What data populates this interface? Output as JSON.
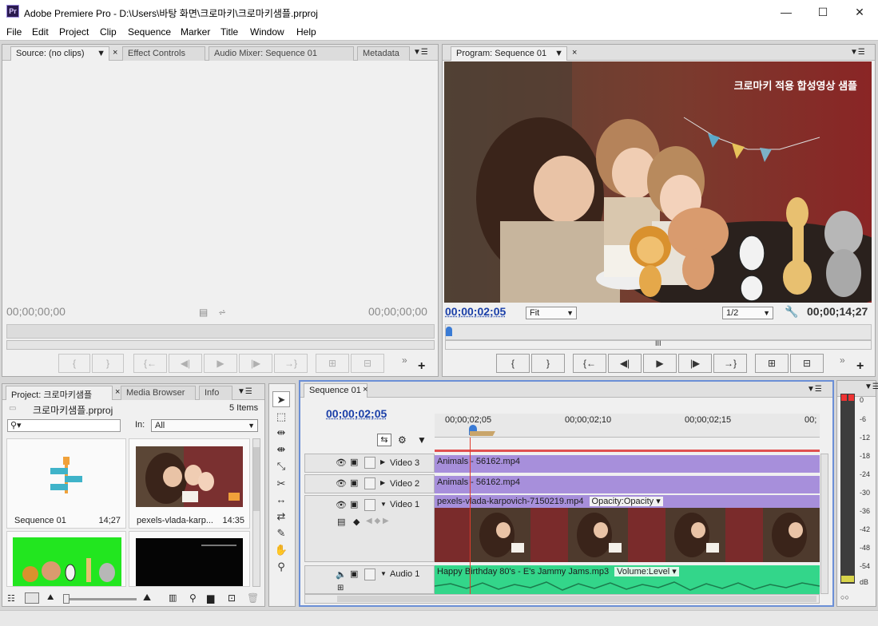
{
  "window": {
    "app_icon": "Pr",
    "title": "Adobe Premiere Pro - D:\\Users\\바탕 화면\\크로마키\\크로마키샘플.prproj",
    "minimize": "—",
    "maximize": "☐",
    "close": "✕"
  },
  "menu": [
    "File",
    "Edit",
    "Project",
    "Clip",
    "Sequence",
    "Marker",
    "Title",
    "Window",
    "Help"
  ],
  "source_panel": {
    "tabs": [
      "Source: (no clips)",
      "Effect Controls",
      "Audio Mixer: Sequence 01",
      "Metadata"
    ],
    "timecode_left": "00;00;00;00",
    "timecode_right": "00;00;00;00"
  },
  "program_panel": {
    "tab": "Program: Sequence 01",
    "overlay_text": "크로마키 적용 합성영상 샘플",
    "timecode_current": "00;00;02;05",
    "zoom": "Fit",
    "resolution": "1/2",
    "timecode_duration": "00;00;14;27"
  },
  "project_panel": {
    "tabs": [
      "Project: 크로마키샘플",
      "Media Browser",
      "Info"
    ],
    "project_file": "크로마키샘플.prproj",
    "items_count": "5 Items",
    "in_label": "In:",
    "in_value": "All",
    "items": [
      {
        "name": "Sequence 01",
        "duration": "14;27"
      },
      {
        "name": "pexels-vlada-karp...",
        "duration": "14:35"
      },
      {
        "name": "",
        "duration": ""
      },
      {
        "name": "",
        "duration": ""
      }
    ]
  },
  "timeline": {
    "tab": "Sequence 01",
    "timecode": "00;00;02;05",
    "ruler": [
      "00;00;02;05",
      "00;00;02;10",
      "00;00;02;15",
      "00;"
    ],
    "tracks": [
      {
        "name": "Video 3",
        "clip": "Animals - 56162.mp4"
      },
      {
        "name": "Video 2",
        "clip": "Animals - 56162.mp4"
      },
      {
        "name": "Video 1",
        "clip": "pexels-vlada-karpovich-7150219.mp4",
        "effect": "Opacity:Opacity"
      },
      {
        "name": "Audio 1",
        "clip": "Happy Birthday 80's - E's Jammy Jams.mp3",
        "effect": "Volume:Level"
      }
    ]
  },
  "audio_meter": {
    "labels": [
      "0",
      "-6",
      "-12",
      "-18",
      "-24",
      "-30",
      "-36",
      "-42",
      "-48",
      "-54",
      "dB"
    ]
  },
  "colors": {
    "timecode_blue": "#1a3fa8",
    "clip_video": "#a78fdb",
    "clip_audio": "#33d68a",
    "playhead": "#e03b2b"
  }
}
